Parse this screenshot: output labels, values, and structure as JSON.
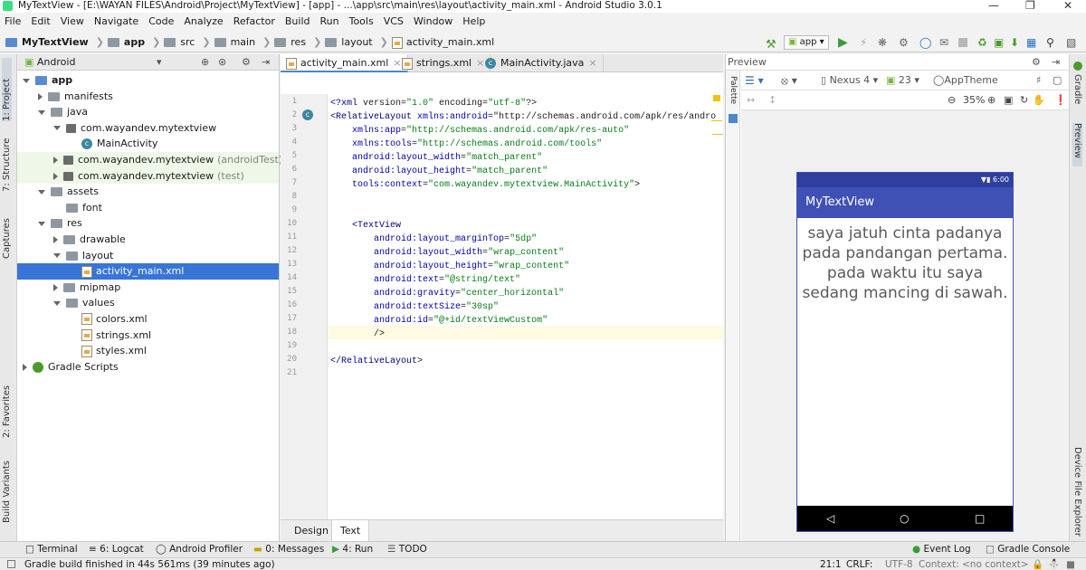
{
  "window": {
    "title": "MyTextView - [E:\\WAYAN FILES\\Android\\Project\\MyTextView] - [app] - ...\\app\\src\\main\\res\\layout\\activity_main.xml - Android Studio 3.0.1"
  },
  "menu": [
    "File",
    "Edit",
    "View",
    "Navigate",
    "Code",
    "Analyze",
    "Refactor",
    "Build",
    "Run",
    "Tools",
    "VCS",
    "Window",
    "Help"
  ],
  "breadcrumb": [
    "MyTextView",
    "app",
    "src",
    "main",
    "res",
    "layout",
    "activity_main.xml"
  ],
  "run_config": "app",
  "left_tabs": [
    "1: Project",
    "7: Structure",
    "Captures",
    "2: Favorites",
    "Build Variants"
  ],
  "right_tabs": [
    "Gradle",
    "Preview",
    "Device File Explorer"
  ],
  "project": {
    "view_mode": "Android",
    "tree": [
      {
        "label": "app",
        "kind": "module",
        "indent": 0,
        "expanded": true
      },
      {
        "label": "manifests",
        "kind": "folder",
        "indent": 1,
        "expanded": false
      },
      {
        "label": "java",
        "kind": "folder",
        "indent": 1,
        "expanded": true
      },
      {
        "label": "com.wayandev.mytextview",
        "kind": "package",
        "indent": 2,
        "expanded": true
      },
      {
        "label": "MainActivity",
        "kind": "class",
        "indent": 3
      },
      {
        "label": "com.wayandev.mytextview",
        "suffix": "(androidTest)",
        "kind": "package",
        "indent": 2,
        "expanded": false
      },
      {
        "label": "com.wayandev.mytextview",
        "suffix": "(test)",
        "kind": "package",
        "indent": 2,
        "expanded": false
      },
      {
        "label": "assets",
        "kind": "folder",
        "indent": 1,
        "expanded": true
      },
      {
        "label": "font",
        "kind": "folder",
        "indent": 2
      },
      {
        "label": "res",
        "kind": "folder",
        "indent": 1,
        "expanded": true
      },
      {
        "label": "drawable",
        "kind": "folder",
        "indent": 2,
        "expanded": false
      },
      {
        "label": "layout",
        "kind": "folder",
        "indent": 2,
        "expanded": true
      },
      {
        "label": "activity_main.xml",
        "kind": "xml",
        "indent": 3,
        "selected": true
      },
      {
        "label": "mipmap",
        "kind": "folder",
        "indent": 2,
        "expanded": false
      },
      {
        "label": "values",
        "kind": "folder",
        "indent": 2,
        "expanded": true
      },
      {
        "label": "colors.xml",
        "kind": "xml",
        "indent": 3
      },
      {
        "label": "strings.xml",
        "kind": "xml",
        "indent": 3
      },
      {
        "label": "styles.xml",
        "kind": "xml",
        "indent": 3
      },
      {
        "label": "Gradle Scripts",
        "kind": "gradle",
        "indent": 0,
        "expanded": false
      }
    ]
  },
  "editor": {
    "tabs": [
      {
        "label": "activity_main.xml",
        "active": true
      },
      {
        "label": "strings.xml",
        "active": false
      },
      {
        "label": "MainActivity.java",
        "active": false
      }
    ],
    "lines": [
      "<?xml version=\"1.0\" encoding=\"utf-8\"?>",
      "<RelativeLayout xmlns:android=\"http://schemas.android.com/apk/res/andro",
      "    xmlns:app=\"http://schemas.android.com/apk/res-auto\"",
      "    xmlns:tools=\"http://schemas.android.com/tools\"",
      "    android:layout_width=\"match_parent\"",
      "    android:layout_height=\"match_parent\"",
      "    tools:context=\"com.wayandev.mytextview.MainActivity\">",
      "",
      "",
      "    <TextView",
      "        android:layout_marginTop=\"5dp\"",
      "        android:layout_width=\"wrap_content\"",
      "        android:layout_height=\"wrap_content\"",
      "        android:text=\"@string/text\"",
      "        android:gravity=\"center_horizontal\"",
      "        android:textSize=\"30sp\"",
      "        android:id=\"@+id/textViewCustom\"",
      "        />",
      "",
      "</RelativeLayout>",
      ""
    ],
    "bottom_tabs": [
      "Design",
      "Text"
    ]
  },
  "preview": {
    "title": "Preview",
    "device": "Nexus 4",
    "api": "23",
    "theme": "AppTheme",
    "zoom": "35%",
    "phone": {
      "time": "6:00",
      "app_name": "MyTextView",
      "text": "saya jatuh cinta padanya pada pandangan pertama. pada waktu itu saya sedang mancing di sawah."
    },
    "palette_label": "Palette"
  },
  "tool_windows": [
    "Terminal",
    "6: Logcat",
    "Android Profiler",
    "0: Messages",
    "4: Run",
    "TODO",
    "Event Log",
    "Gradle Console"
  ],
  "status": {
    "message": "Gradle build finished in 44s 561ms (39 minutes ago)",
    "position": "21:1",
    "line_sep": "CRLF:",
    "encoding": "UTF-8",
    "context": "Context: <no context>"
  }
}
